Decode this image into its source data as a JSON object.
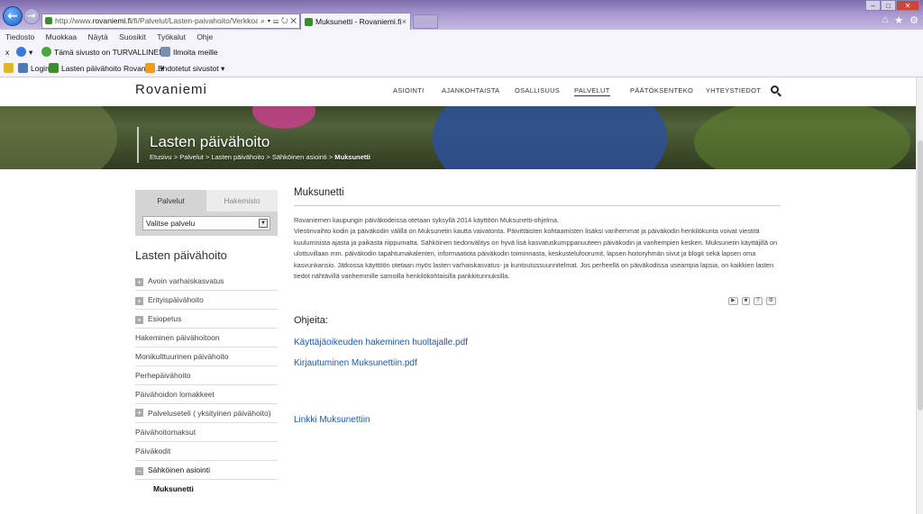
{
  "browser": {
    "address": {
      "prefix": "http://www.",
      "domain": "rovaniemi.fi",
      "path": "/fi/Palvelut/Lasten-paivahoito/Verkkoasioi",
      "tools": "⌕ ▾ ☰ ↻ ✕"
    },
    "active_tab": {
      "title": "Muksunetti - Rovaniemi.fi",
      "close": "×"
    },
    "menu": [
      "Tiedosto",
      "Muokkaa",
      "Näytä",
      "Suosikit",
      "Työkalut",
      "Ohje"
    ],
    "command_bar": {
      "close": "x",
      "safe_site": "Tämä sivusto on TURVALLINEN",
      "report": "Ilmoita meille"
    },
    "favorites": {
      "login": "Login",
      "lasten": "Lasten päivähoito Rovanie...",
      "suggested": "Ehdotetut sivustot"
    }
  },
  "site": {
    "logo": "Rovaniemi",
    "nav": [
      {
        "label": "ASIOINTI"
      },
      {
        "label": "AJANKOHTAISTA"
      },
      {
        "label": "OSALLISUUS"
      },
      {
        "label": "PALVELUT"
      },
      {
        "label": "PÄÄTÖKSENTEKO"
      },
      {
        "label": "YHTEYSTIEDOT"
      }
    ],
    "active_nav": "PALVELUT"
  },
  "hero": {
    "title": "Lasten päivähoito",
    "breadcrumb": [
      "Etusivu",
      "Palvelut",
      "Lasten päivähoito",
      "Sähköinen asiointi",
      "Muksunetti"
    ],
    "separator": ">"
  },
  "sidebar": {
    "tabs": [
      "Palvelut",
      "Hakemisto"
    ],
    "select_value": "Valitse palvelu",
    "heading": "Lasten päivähoito",
    "items": [
      {
        "label": "Avoin varhaiskasvatus",
        "expandable": true
      },
      {
        "label": "Erityispäivähoito",
        "expandable": true
      },
      {
        "label": "Esiopetus",
        "expandable": true
      },
      {
        "label": "Hakeminen päivähoitoon",
        "expandable": false
      },
      {
        "label": "Monikulttuurinen päivähoito",
        "expandable": false
      },
      {
        "label": "Perhepäivähoito",
        "expandable": false
      },
      {
        "label": "Päivähoidon lomakkeet",
        "expandable": false
      },
      {
        "label": "Palveluseteli ( yksityinen päivähoito)",
        "expandable": true
      },
      {
        "label": "Päivähoitomaksut",
        "expandable": false
      },
      {
        "label": "Päiväkodit",
        "expandable": false
      },
      {
        "label": "Sähköinen asiointi",
        "expandable": true,
        "open": true
      }
    ],
    "sub_item": "Muksunetti"
  },
  "content": {
    "title": "Muksunetti",
    "intro": "Rovaniemen kaupungin päiväkodeissa otetaan syksyllä 2014 käyttöön Muksunetti-ohjelma.",
    "body": "Viestinvaihto kodin ja päiväkodin välillä on Muksunetin kautta vaivatonta. Päivittäisten kohtaamisten lisäksi vanhemmat ja päiväkodin henkilökunta voivat viestitä kuulumisista ajasta ja paikasta riippumatta. Sähköinen tiedonvälitys on hyvä lisä kasvatuskumppanuuteen päiväkodin ja vanhempien kesken. Muksunetin käyttäjillä on ulottuvillaan mm. päiväkodin tapahtumakalenteri, informaatiota päiväkodin toiminnasta, keskustelufoorumit, lapsen hoitoryhmän sivut ja blogit sekä lapsen oma kasvunkansio. Jätkossa käyttöön otetaan myös lasten varhaiskasvatus- ja kuntoutussuunnitelmat. Jos perheellä on päiväkodissa useampia lapsia, on kaikkien lasten tiedot nähtävillä vanhemmille samoilla henkilökohtaisilla pankkitunnuksilla.",
    "reader_controls": [
      "▶",
      "■",
      "?",
      "⚙"
    ],
    "instructions_heading": "Ohjeita:",
    "links": [
      "Käyttäjäoikeuden hakeminen huoltajalle.pdf",
      "Kirjautuminen Muksunettiin.pdf",
      "Linkki Muksunettiin"
    ]
  }
}
